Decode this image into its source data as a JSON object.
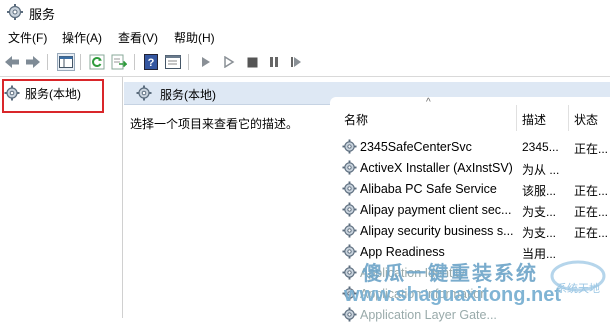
{
  "window": {
    "title": "服务"
  },
  "menu": [
    {
      "label": "文件(F)"
    },
    {
      "label": "操作(A)"
    },
    {
      "label": "查看(V)"
    },
    {
      "label": "帮助(H)"
    }
  ],
  "toolbar": {
    "icons": [
      "back-icon",
      "forward-icon",
      "show-pane-icon",
      "refresh-icon",
      "export-icon",
      "help-icon",
      "properties-icon",
      "start-icon",
      "start-alt-icon",
      "stop-icon",
      "pause-icon",
      "restart-icon"
    ]
  },
  "tree": {
    "label": "服务(本地)"
  },
  "pane": {
    "title": "服务(本地)",
    "description": "选择一个项目来查看它的描述。"
  },
  "table": {
    "columns": {
      "name": "名称",
      "desc": "描述",
      "state": "状态"
    },
    "rows": [
      {
        "name": "2345SafeCenterSvc",
        "desc": "2345...",
        "state": "正在..."
      },
      {
        "name": "ActiveX Installer (AxInstSV)",
        "desc": "为从 ...",
        "state": ""
      },
      {
        "name": "Alibaba PC Safe Service",
        "desc": "该服...",
        "state": "正在..."
      },
      {
        "name": "Alipay payment client sec...",
        "desc": "为支...",
        "state": "正在..."
      },
      {
        "name": "Alipay security business s...",
        "desc": "为支...",
        "state": "正在..."
      },
      {
        "name": "App Readiness",
        "desc": "当用...",
        "state": ""
      },
      {
        "name": "Application Identity",
        "desc": "",
        "state": ""
      },
      {
        "name": "Application Information",
        "desc": "",
        "state": ""
      },
      {
        "name": "Application Layer Gate...",
        "desc": "",
        "state": ""
      }
    ]
  },
  "watermark": {
    "cn": "傻瓜一键重装系统",
    "url": "www.shaguaxitong.net",
    "logo_text": "系统天地"
  },
  "colors": {
    "header_bg": "#dee8f4",
    "highlight": "#d9262a",
    "watermark": "#6fa6c9"
  }
}
